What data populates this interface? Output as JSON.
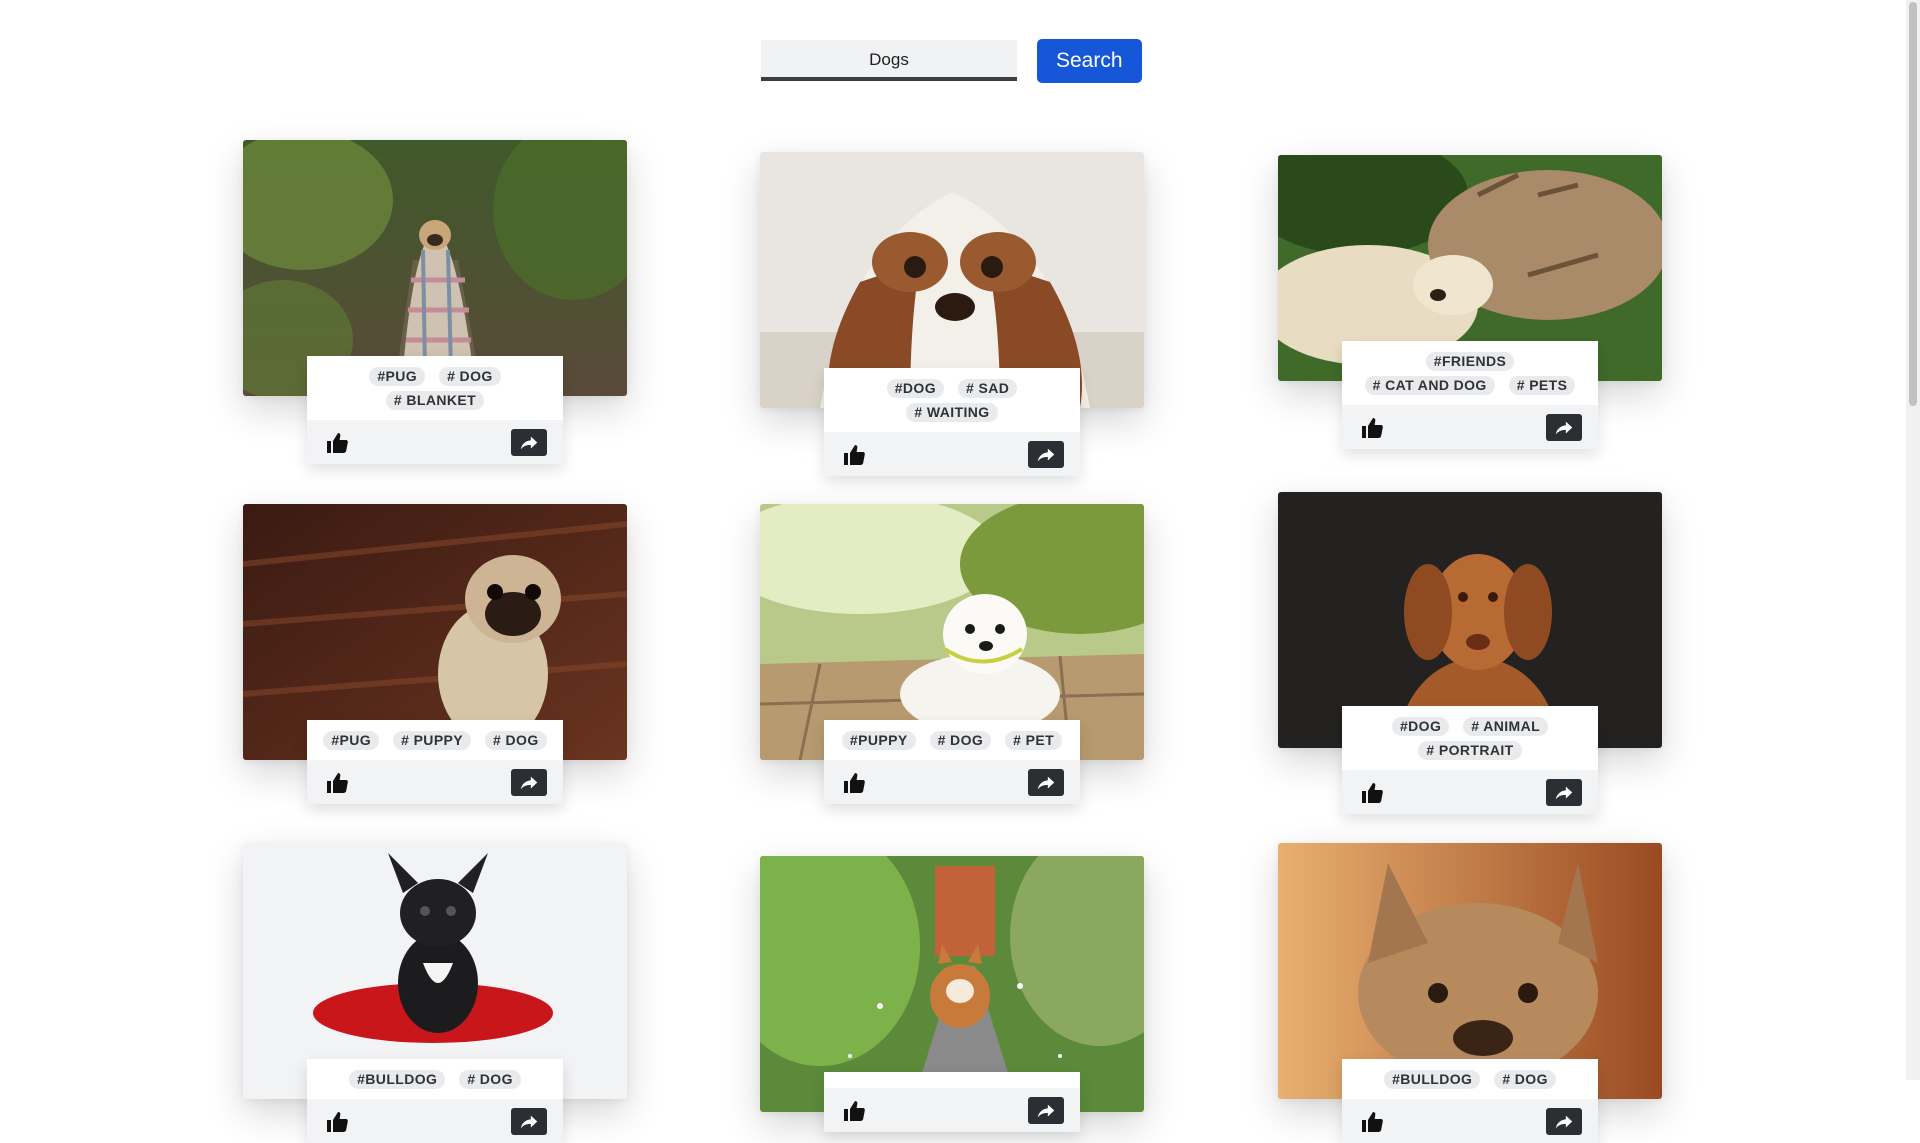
{
  "search": {
    "value": "Dogs",
    "button_label": "Search"
  },
  "cards": [
    {
      "tags": [
        "#PUG",
        "# DOG",
        "# BLANKET"
      ],
      "image": "pug-in-blanket"
    },
    {
      "tags": [
        "#DOG",
        "# SAD",
        "# WAITING"
      ],
      "image": "spaniel-lying"
    },
    {
      "tags": [
        "#FRIENDS",
        "# CAT AND DOG",
        "# PETS"
      ],
      "image": "cat-and-dog"
    },
    {
      "tags": [
        "#PUG",
        "# PUPPY",
        "# DOG"
      ],
      "image": "pug-puppy"
    },
    {
      "tags": [
        "#PUPPY",
        "# DOG",
        "# PET"
      ],
      "image": "white-puppy"
    },
    {
      "tags": [
        "#DOG",
        "# ANIMAL",
        "# PORTRAIT"
      ],
      "image": "vizsla-portrait"
    },
    {
      "tags": [
        "#BULLDOG",
        "# DOG"
      ],
      "image": "french-bulldog-pillow"
    },
    {
      "tags": [],
      "image": "corgi-on-tracks"
    },
    {
      "tags": [
        "#BULLDOG",
        "# DOG"
      ],
      "image": "bulldog-resting"
    }
  ],
  "icons": {
    "like": "thumbs-up-icon",
    "share": "share-arrow-icon"
  },
  "colors": {
    "accent": "#1657d9",
    "tag_bg": "#e9eaec",
    "share_bg": "#2b2e33"
  }
}
